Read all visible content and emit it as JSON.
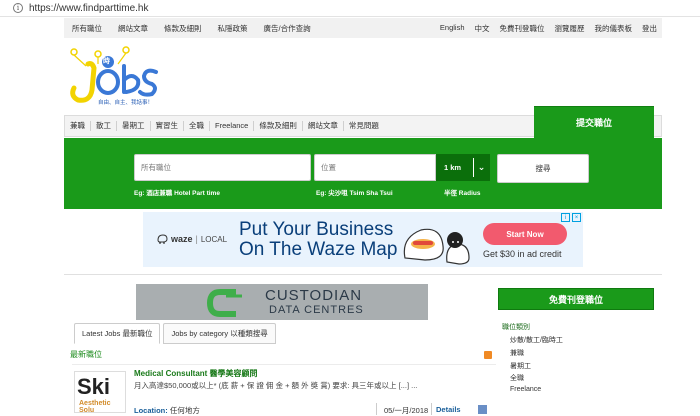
{
  "browser": {
    "url": "https://www.findparttime.hk"
  },
  "topnav": {
    "left": [
      "所有職位",
      "網站文章",
      "條款及細則",
      "私隱政策",
      "廣告/合作查詢"
    ],
    "right": [
      "English",
      "中文",
      "免費刊登職位",
      "瀏覽履歷",
      "我的儀表板",
      "登出"
    ]
  },
  "logo": {
    "text": "Jobs",
    "badge": "時",
    "tagline": "自由、自主、我話事！"
  },
  "menu": {
    "items": [
      "兼職",
      "散工",
      "暑期工",
      "實習生",
      "全職",
      "Freelance",
      "條款及細則",
      "網站文章",
      "常見問題"
    ],
    "submit": "提交職位"
  },
  "search": {
    "jobs_placeholder": "所有職位",
    "location_placeholder": "位置",
    "radius": "1 km",
    "button": "搜尋",
    "hint_jobs": "Eg: 酒店兼職 Hotel Part time",
    "hint_location": "Eg: 尖沙咀 Tsim Sha Tsui",
    "hint_radius": "半徑 Radius"
  },
  "ad": {
    "brand": "waze",
    "brand_sep": "|",
    "brand_sub": "LOCAL",
    "headline_line1": "Put Your Business",
    "headline_line2": "On The Waze Map",
    "cta": "Start Now",
    "sub": "Get $30 in ad credit"
  },
  "banner": {
    "word1": "CUSTODIAN",
    "word2": "DATA CENTRES"
  },
  "tabs": [
    "Latest Jobs 最新職位",
    "Jobs by category 以種類搜尋"
  ],
  "latest": {
    "heading": "最新職位",
    "job": {
      "thumb_big": "Ski",
      "thumb_small": "Aesthetic Solu",
      "title": "Medical Consultant 醫學美容顧問",
      "desc": "月入高達$50,000或以上* (底 薪 + 保 證 佣 金 + 額 外 獎 賞) 要求: 具三年或以上 [...] ...",
      "loc_label": "Location:",
      "loc_value": "任何地方",
      "date": "05/一月/2018",
      "details": "Details"
    }
  },
  "sidebar": {
    "post_button": "免費刊登職位",
    "category_heading": "職位類別",
    "categories": [
      "炒散/散工/臨時工",
      "兼職",
      "暑期工",
      "全職",
      "Freelance"
    ]
  },
  "colors": {
    "green": "#1a9a1a",
    "dark_green": "#0b6f0b",
    "ad_blue": "#0a3f7a",
    "cta_pink": "#f25a6e"
  }
}
